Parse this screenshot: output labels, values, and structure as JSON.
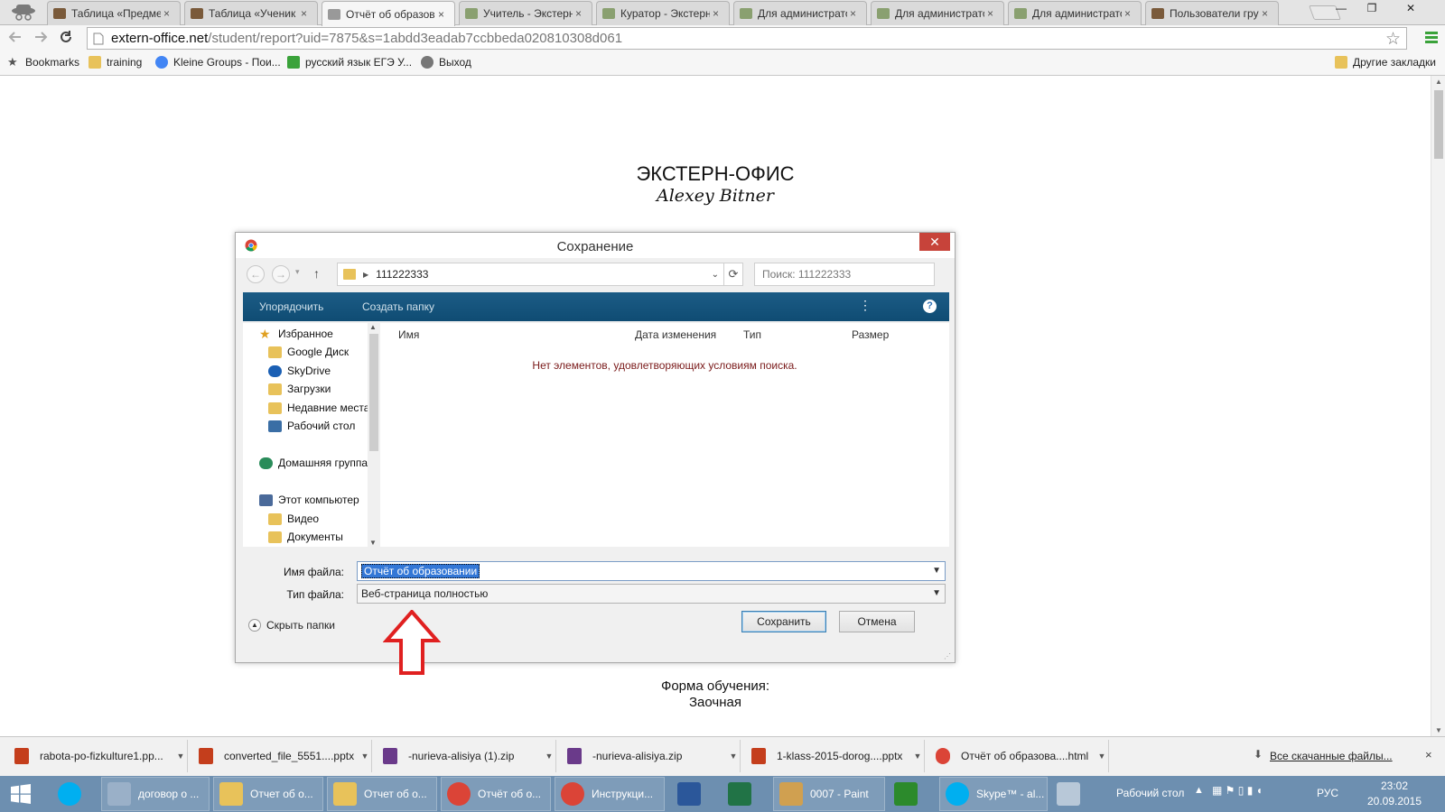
{
  "browser": {
    "tabs": [
      {
        "label": "Таблица «Предме",
        "icon": "hat-icon",
        "active": false
      },
      {
        "label": "Таблица «Ученик",
        "icon": "hat-icon",
        "active": false
      },
      {
        "label": "Отчёт об образов",
        "icon": "page-icon",
        "active": true
      },
      {
        "label": "Учитель - Экстерн",
        "icon": "table-icon",
        "active": false
      },
      {
        "label": "Куратор - Экстерн",
        "icon": "table-icon",
        "active": false
      },
      {
        "label": "Для администрато",
        "icon": "table-icon",
        "active": false
      },
      {
        "label": "Для администрато",
        "icon": "table-icon",
        "active": false
      },
      {
        "label": "Для администрато",
        "icon": "table-icon",
        "active": false
      },
      {
        "label": "Пользователи гру",
        "icon": "hat-icon",
        "active": false
      }
    ],
    "tab_close": "×",
    "window_controls": {
      "minimize": "—",
      "restore": "❐",
      "close": "✕"
    },
    "url_host": "extern-office.net",
    "url_path": "/student/report?uid=7875&s=1abdd3eadab7ccbbeda020810308d061",
    "bookmarks": [
      {
        "label": "Bookmarks",
        "icon": "star-icon"
      },
      {
        "label": "training",
        "icon": "folder-icon"
      },
      {
        "label": "Kleine Groups - Пои...",
        "icon": "google-icon"
      },
      {
        "label": "русский язык ЕГЭ У...",
        "icon": "check-icon"
      },
      {
        "label": "Выход",
        "icon": "globe-icon"
      }
    ],
    "other_bookmarks": "Другие закладки"
  },
  "page": {
    "logo_title": "ЭКСТЕРН-ОФИС",
    "logo_signature": "Alexey Bitner",
    "form_label": "Форма обучения:",
    "form_value": "Заочная"
  },
  "dialog": {
    "title": "Сохранение",
    "close": "✕",
    "folder": "111222333",
    "search_placeholder": "Поиск: 111222333",
    "commands": {
      "organize": "Упорядочить",
      "new_folder": "Создать папку",
      "help": "?"
    },
    "nav": [
      {
        "label": "Избранное",
        "icon": "star-icon"
      },
      {
        "label": "Google Диск",
        "icon": "folder-icon"
      },
      {
        "label": "SkyDrive",
        "icon": "cloud-icon"
      },
      {
        "label": "Загрузки",
        "icon": "folder-icon"
      },
      {
        "label": "Недавние места",
        "icon": "folder-icon"
      },
      {
        "label": "Рабочий стол",
        "icon": "desktop-icon"
      },
      {
        "label": "Домашняя группа",
        "icon": "homegroup-icon"
      },
      {
        "label": "Этот компьютер",
        "icon": "computer-icon"
      },
      {
        "label": "Видео",
        "icon": "folder-icon"
      },
      {
        "label": "Документы",
        "icon": "folder-icon"
      }
    ],
    "columns": {
      "name": "Имя",
      "modified": "Дата изменения",
      "type": "Тип",
      "size": "Размер"
    },
    "empty_message": "Нет элементов, удовлетворяющих условиям поиска.",
    "filename_label": "Имя файла:",
    "filename_value": "Отчёт об образовании",
    "filetype_label": "Тип файла:",
    "filetype_value": "Веб-страница полностью",
    "hide_folders": "Скрыть папки",
    "save_button": "Сохранить",
    "cancel_button": "Отмена"
  },
  "downloads": {
    "items": [
      {
        "name": "rabota-po-fizkulture1.pp...",
        "icon": "powerpoint-icon"
      },
      {
        "name": "converted_file_5551....pptx",
        "icon": "powerpoint-icon"
      },
      {
        "name": "-nurieva-alisiya (1).zip",
        "icon": "archive-icon"
      },
      {
        "name": "-nurieva-alisiya.zip",
        "icon": "archive-icon"
      },
      {
        "name": "1-klass-2015-dorog....pptx",
        "icon": "powerpoint-icon"
      },
      {
        "name": "Отчёт об образова....html",
        "icon": "chrome-icon"
      }
    ],
    "all_downloads": "Все скачанные файлы...",
    "close": "×"
  },
  "taskbar": {
    "items": [
      {
        "label": "",
        "icon": "windows-icon"
      },
      {
        "label": "",
        "icon": "skype-icon"
      },
      {
        "label": "договор о ...",
        "icon": "search-icon"
      },
      {
        "label": "Отчет об о...",
        "icon": "folder-icon"
      },
      {
        "label": "Отчет об о...",
        "icon": "folder-icon"
      },
      {
        "label": "Отчёт об о...",
        "icon": "chrome-icon"
      },
      {
        "label": "Инструкци...",
        "icon": "chrome-icon"
      },
      {
        "label": "",
        "icon": "word-icon"
      },
      {
        "label": "",
        "icon": "excel-icon"
      },
      {
        "label": "0007 - Paint",
        "icon": "paint-icon"
      },
      {
        "label": "",
        "icon": "camtasia-icon"
      },
      {
        "label": "Skype™ - al...",
        "icon": "skype-icon"
      },
      {
        "label": "",
        "icon": "calculator-icon"
      }
    ],
    "desktop_label": "Рабочий стол",
    "language": "РУС",
    "time": "23:02",
    "date": "20.09.2015"
  },
  "colors": {
    "command_bar": "#0f4c73",
    "close_red": "#c7433a",
    "taskbar": "#6d8fb0",
    "arrow_red": "#e02020",
    "empty_message": "#7a1a1a"
  }
}
